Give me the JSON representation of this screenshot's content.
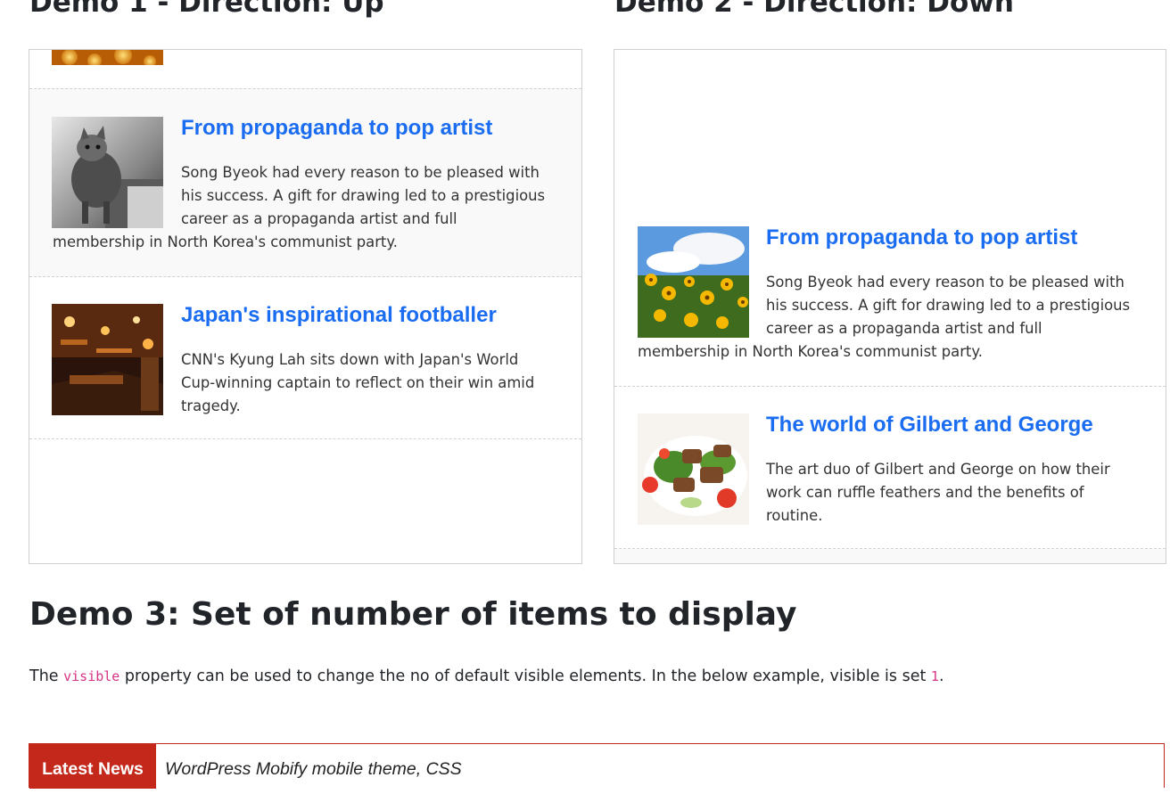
{
  "demo1": {
    "title": "Demo 1 - Direction: Up",
    "items": [
      {
        "title": "From propaganda to pop artist",
        "desc": "Song Byeok had every reason to be pleased with his success. A gift for drawing led to a prestigious career as a propaganda artist and full membership in North Korea's communist party.",
        "image": "grayscale cat photo"
      },
      {
        "title": "Japan's inspirational footballer",
        "desc": "CNN's Kyung Lah sits down with Japan's World Cup-winning captain to reflect on their win amid tragedy.",
        "image": "bar interior photo"
      }
    ]
  },
  "demo2": {
    "title": "Demo 2 - Direction: Down",
    "items": [
      {
        "title": "From propaganda to pop artist",
        "desc": "Song Byeok had every reason to be pleased with his success. A gift for drawing led to a prestigious career as a propaganda artist and full membership in North Korea's communist party.",
        "image": "yellow flowers photo"
      },
      {
        "title": "The world of Gilbert and George",
        "desc": "The art duo of Gilbert and George on how their work can ruffle feathers and the benefits of routine.",
        "image": "salad plate photo"
      }
    ]
  },
  "demo3": {
    "title": "Demo 3: Set of number of items to display",
    "note_before": "The ",
    "note_code": "visible",
    "note_middle": " property can be used to change the no of default visible elements. In the below example, visible is set ",
    "note_code2": "1",
    "note_after": "."
  },
  "ticker": {
    "label": "Latest News",
    "text": "WordPress Mobify mobile theme, CSS"
  },
  "colors": {
    "link": "#1a6cf0",
    "ticker_red": "#c4281a",
    "code_pink": "#d63384"
  }
}
